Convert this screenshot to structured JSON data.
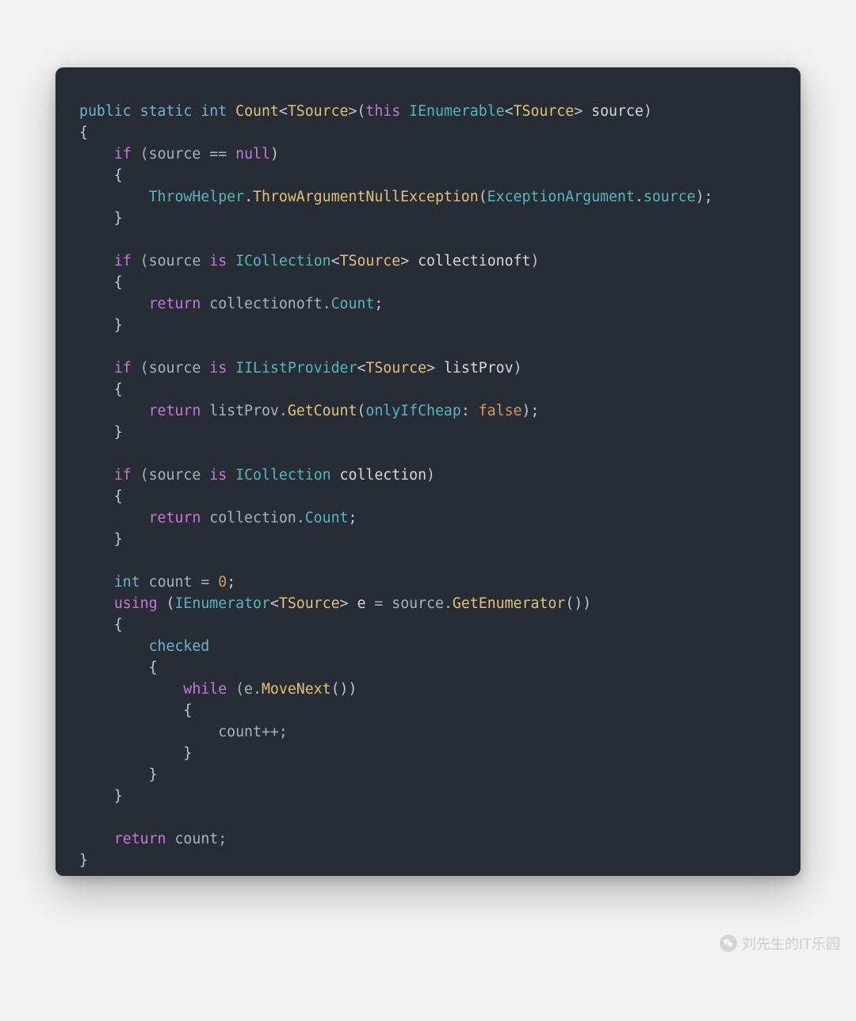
{
  "colors": {
    "pageBg": "#f2f2f2",
    "cardBg": "#282c34",
    "textDefault": "#abb2bf",
    "keywordBlue": "#6fb3d2",
    "keywordPurple": "#c678dd",
    "typeYellow": "#e5c07b",
    "numberOrange": "#d19a66",
    "identCyan": "#56b6c2",
    "punct": "#c3c7d1"
  },
  "watermark": {
    "text": "刘先生的IT乐园",
    "iconName": "wechat-icon"
  },
  "code": {
    "t01a": "public",
    "t01b": " ",
    "t01c": "static",
    "t01d": " ",
    "t01e": "int",
    "t01f": " ",
    "t01g": "Count",
    "t01h": "<",
    "t01i": "TSource",
    "t01j": ">(",
    "t01k": "this",
    "t01l": " ",
    "t01m": "IEnumerable",
    "t01n": "<",
    "t01o": "TSource",
    "t01p": "> ",
    "t01q": "source",
    "t01r": ")",
    "t02a": "{",
    "t03a": "    ",
    "t03b": "if",
    "t03c": " (source == ",
    "t03d": "null",
    "t03e": ")",
    "t04a": "    {",
    "t05a": "        ",
    "t05b": "ThrowHelper",
    "t05c": ".",
    "t05d": "ThrowArgumentNullException",
    "t05e": "(",
    "t05f": "ExceptionArgument",
    "t05g": ".",
    "t05h": "source",
    "t05i": ");",
    "t06a": "    }",
    "t07a": "",
    "t08a": "    ",
    "t08b": "if",
    "t08c": " (source ",
    "t08d": "is",
    "t08e": " ",
    "t08f": "ICollection",
    "t08g": "<",
    "t08h": "TSource",
    "t08i": "> ",
    "t08j": "collectionoft",
    "t08k": ")",
    "t09a": "    {",
    "t10a": "        ",
    "t10b": "return",
    "t10c": " collectionoft.",
    "t10d": "Count",
    "t10e": ";",
    "t11a": "    }",
    "t12a": "",
    "t13a": "    ",
    "t13b": "if",
    "t13c": " (source ",
    "t13d": "is",
    "t13e": " ",
    "t13f": "IIListProvider",
    "t13g": "<",
    "t13h": "TSource",
    "t13i": "> ",
    "t13j": "listProv",
    "t13k": ")",
    "t14a": "    {",
    "t15a": "        ",
    "t15b": "return",
    "t15c": " listProv.",
    "t15d": "GetCount",
    "t15e": "(",
    "t15f": "onlyIfCheap",
    "t15g": ": ",
    "t15h": "false",
    "t15i": ");",
    "t16a": "    }",
    "t17a": "",
    "t18a": "    ",
    "t18b": "if",
    "t18c": " (source ",
    "t18d": "is",
    "t18e": " ",
    "t18f": "ICollection",
    "t18g": " ",
    "t18h": "collection",
    "t18i": ")",
    "t19a": "    {",
    "t20a": "        ",
    "t20b": "return",
    "t20c": " collection.",
    "t20d": "Count",
    "t20e": ";",
    "t21a": "    }",
    "t22a": "",
    "t23a": "    ",
    "t23b": "int",
    "t23c": " count = ",
    "t23d": "0",
    "t23e": ";",
    "t24a": "    ",
    "t24b": "using",
    "t24c": " (",
    "t24d": "IEnumerator",
    "t24e": "<",
    "t24f": "TSource",
    "t24g": "> ",
    "t24h": "e",
    "t24i": " = source.",
    "t24j": "GetEnumerator",
    "t24k": "())",
    "t25a": "    {",
    "t26a": "        ",
    "t26b": "checked",
    "t27a": "        {",
    "t28a": "            ",
    "t28b": "while",
    "t28c": " (e.",
    "t28d": "MoveNext",
    "t28e": "())",
    "t29a": "            {",
    "t30a": "                count++;",
    "t31a": "            }",
    "t32a": "        }",
    "t33a": "    }",
    "t34a": "",
    "t35a": "    ",
    "t35b": "return",
    "t35c": " count;",
    "t36a": "}"
  }
}
